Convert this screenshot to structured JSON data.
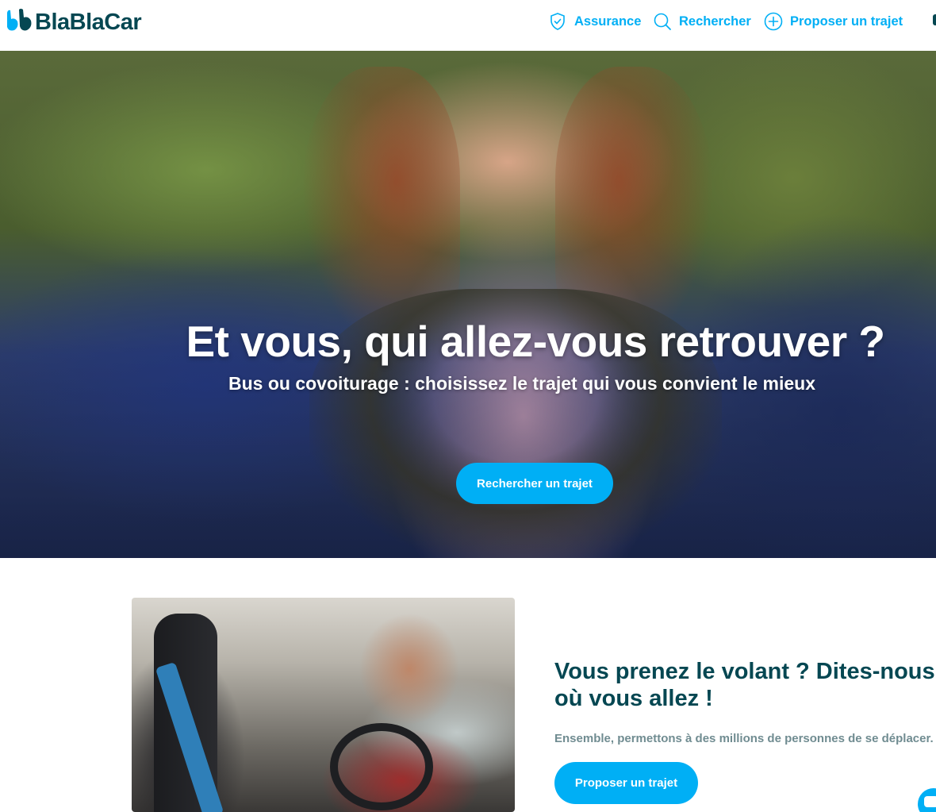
{
  "brand": {
    "name": "BlaBlaCar",
    "primary_color": "#054752",
    "accent_color": "#00AFF5"
  },
  "header": {
    "nav": [
      {
        "label": "Assurance",
        "icon": "shield-check-icon"
      },
      {
        "label": "Rechercher",
        "icon": "search-icon"
      },
      {
        "label": "Proposer un trajet",
        "icon": "plus-circle-icon"
      }
    ]
  },
  "hero": {
    "title": "Et vous, qui allez-vous retrouver ?",
    "subtitle": "Bus ou covoiturage : choisissez le trajet qui vous convient le mieux",
    "cta_label": "Rechercher un trajet"
  },
  "driver_section": {
    "title": "Vous prenez le volant ? Dites-nous où vous allez !",
    "text": "Ensemble, permettons à des millions de personnes de se déplacer.",
    "cta_label": "Proposer un trajet"
  }
}
